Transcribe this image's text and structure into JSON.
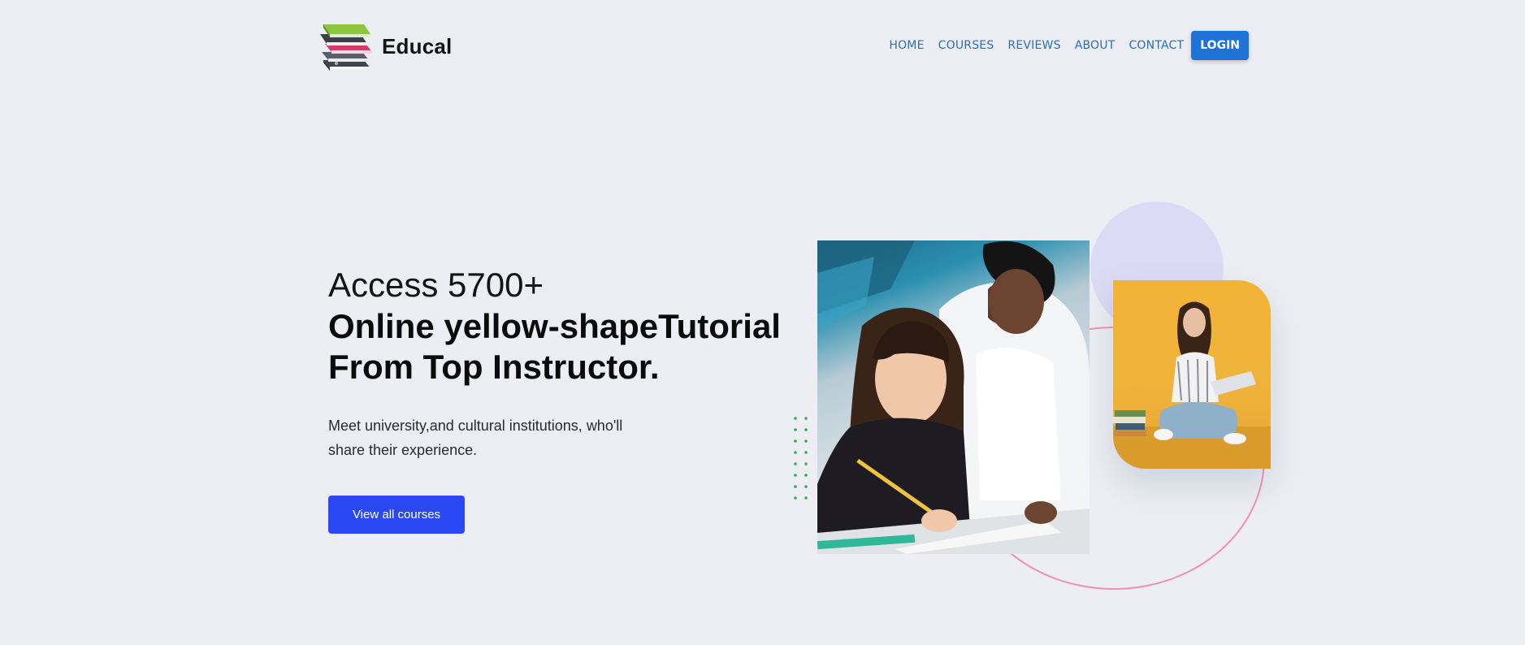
{
  "brand": {
    "name": "Educal"
  },
  "nav": {
    "items": [
      "HOME",
      "COURSES",
      "REVIEWS",
      "ABOUT",
      "CONTACT"
    ],
    "login_label": "LOGIN"
  },
  "hero": {
    "line1": "Access 5700+",
    "line2": "Online yellow-shapeTutorial",
    "line3": "From Top Instructor.",
    "subtitle": "Meet university,and cultural institutions, who'll share their experience.",
    "cta_label": "View all courses"
  },
  "colors": {
    "background": "#eceef3",
    "nav_link": "#2a6fb8",
    "login_button": "#1f73d6",
    "cta_button": "#2a49f5",
    "purple_circle": "#dcdaf4",
    "pink_ring": "#f18fb2",
    "dots": "#2fb04f",
    "yellow_card": "#f2b437"
  },
  "icons": {
    "logo": "book-stack-icon",
    "main_photo": "students-studying-photo",
    "side_photo": "woman-with-laptop-photo"
  }
}
